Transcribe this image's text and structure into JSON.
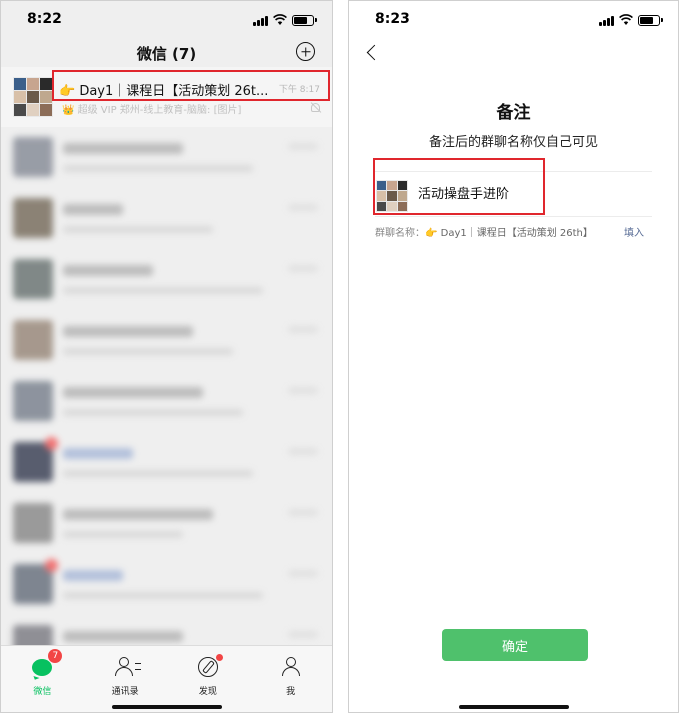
{
  "left": {
    "status_time": "8:22",
    "nav_title": "微信 (7)",
    "first_chat": {
      "title": "👉 Day1｜课程日【活动策划 26t...",
      "time": "下午 8:17",
      "preview": "👑 超级 VIP 郑州-线上教育-脑脑: [图片]"
    },
    "tabs": [
      {
        "label": "微信",
        "badge": "7",
        "icon": "chat-bubble-icon"
      },
      {
        "label": "通讯录",
        "icon": "contacts-icon"
      },
      {
        "label": "发现",
        "icon": "compass-icon"
      },
      {
        "label": "我",
        "icon": "me-icon"
      }
    ]
  },
  "right": {
    "status_time": "8:23",
    "title": "备注",
    "subtitle": "备注后的群聊名称仅自己可见",
    "remark_value": "活动操盘手进阶",
    "group_name_label": "群聊名称：",
    "group_name_value": "👉 Day1｜课程日【活动策划 26th】",
    "fill_label": "填入",
    "confirm_label": "确定"
  },
  "colors": {
    "accent_green": "#07c160",
    "button_green": "#4fc16c",
    "highlight_red": "#e0262d",
    "link_blue": "#576b95"
  }
}
